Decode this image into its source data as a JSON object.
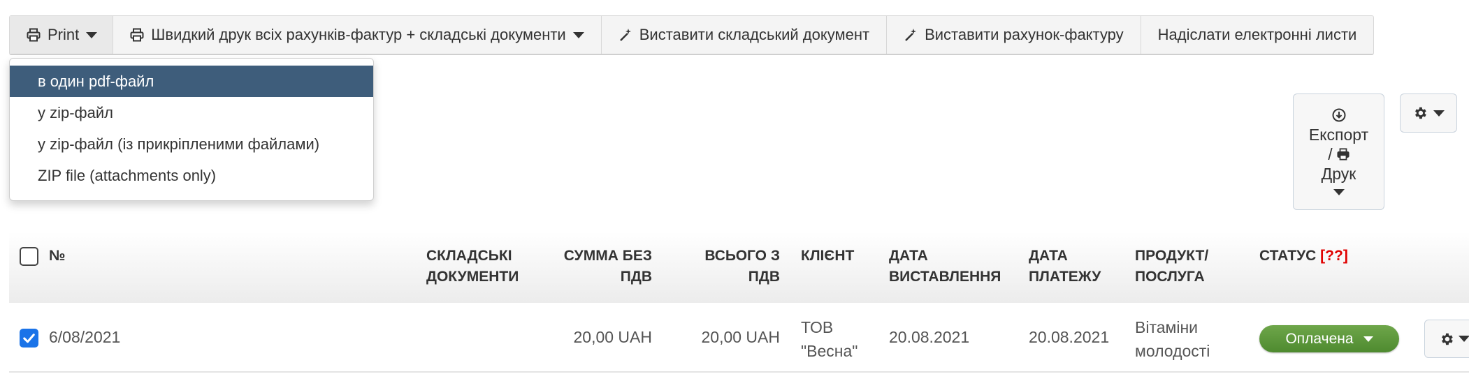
{
  "toolbar": {
    "print_label": "Print",
    "quick_print_label": "Швидкий друк всіх рахунків-фактур + складські документи",
    "warehouse_doc_label": "Виставити складський документ",
    "invoice_label": "Виставити рахунок-фактуру",
    "email_label": "Надіслати електронні листи"
  },
  "print_menu": {
    "items": [
      {
        "label": "в один pdf-файл",
        "active": true
      },
      {
        "label": "у zip-файл",
        "active": false
      },
      {
        "label": "у zip-файл (із прикріпленими файлами)",
        "active": false
      },
      {
        "label": "ZIP file (attachments only)",
        "active": false
      }
    ]
  },
  "export": {
    "line1": "Експорт",
    "line2": "/",
    "line3": "Друк"
  },
  "table": {
    "headers": {
      "number": "№",
      "warehouse_docs_1": "СКЛАДСЬКІ",
      "warehouse_docs_2": "ДОКУМЕНТИ",
      "net_1": "СУММА БЕЗ",
      "net_2": "ПДВ",
      "gross_1": "ВСЬОГО З",
      "gross_2": "ПДВ",
      "client": "КЛІЄНТ",
      "issue_date_1": "ДАТА",
      "issue_date_2": "ВИСТАВЛЕННЯ",
      "payment_date_1": "ДАТА",
      "payment_date_2": "ПЛАТЕЖУ",
      "product_1": "ПРОДУКТ/",
      "product_2": "ПОСЛУГА",
      "status": "СТАТУС",
      "status_help": "[??]"
    },
    "rows": [
      {
        "checked": true,
        "number": "6/08/2021",
        "net": "20,00 UAH",
        "gross": "20,00 UAH",
        "client_1": "ТОВ",
        "client_2": "\"Весна\"",
        "issue_date": "20.08.2021",
        "payment_date": "20.08.2021",
        "product_1": "Вітаміни",
        "product_2": "молодості",
        "status": "Оплачена"
      }
    ]
  },
  "colors": {
    "menu_active_bg": "#3e5d7b",
    "status_paid": "#5a962f",
    "checkbox_checked": "#1a73e8",
    "help_marker": "#e00000"
  }
}
